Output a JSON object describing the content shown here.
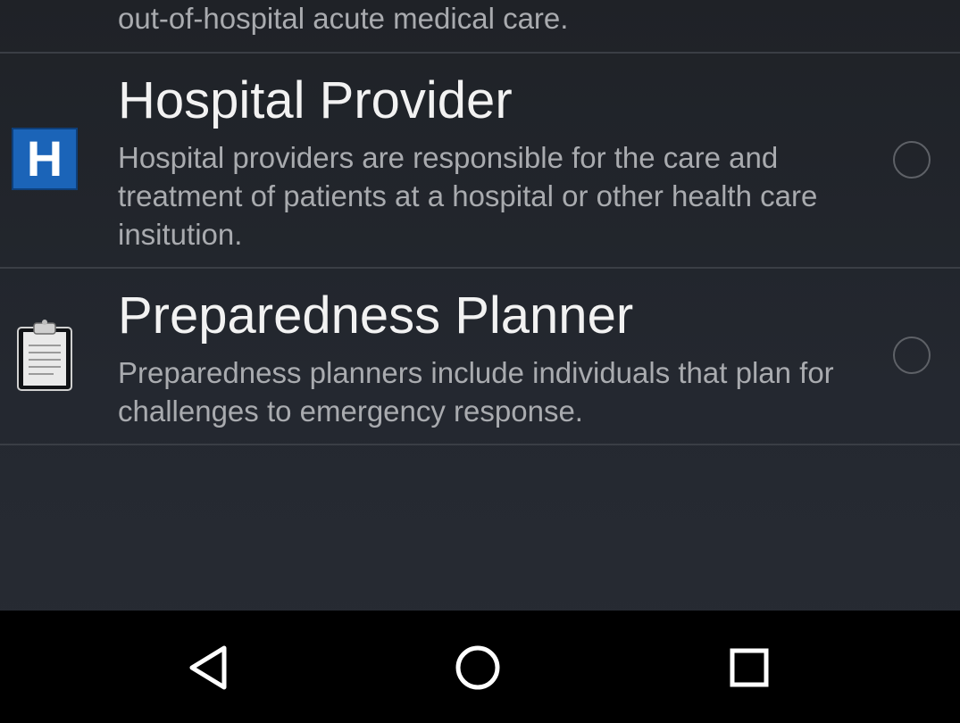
{
  "list": {
    "items": [
      {
        "title": "",
        "description": "out-of-hospital acute medical care.",
        "icon": "partial-row",
        "selected": false
      },
      {
        "title": "Hospital Provider",
        "description": "Hospital providers are responsible for the care and treatment of patients at a hospital or other health care insitution.",
        "icon": "hospital-icon",
        "icon_letter": "H",
        "selected": false
      },
      {
        "title": "Preparedness Planner",
        "description": "Preparedness planners include individuals that plan for challenges to emergency response.",
        "icon": "clipboard-icon",
        "selected": false
      }
    ]
  },
  "navigation_bar": {
    "back": "back-icon",
    "home": "home-icon",
    "recents": "recents-icon"
  },
  "colors": {
    "background": "#262a31",
    "title_text": "#f2f2f2",
    "description_text": "#a9abaf",
    "divider": "#3a3e45",
    "hospital_blue": "#1b64b8",
    "nav_background": "#000000"
  }
}
